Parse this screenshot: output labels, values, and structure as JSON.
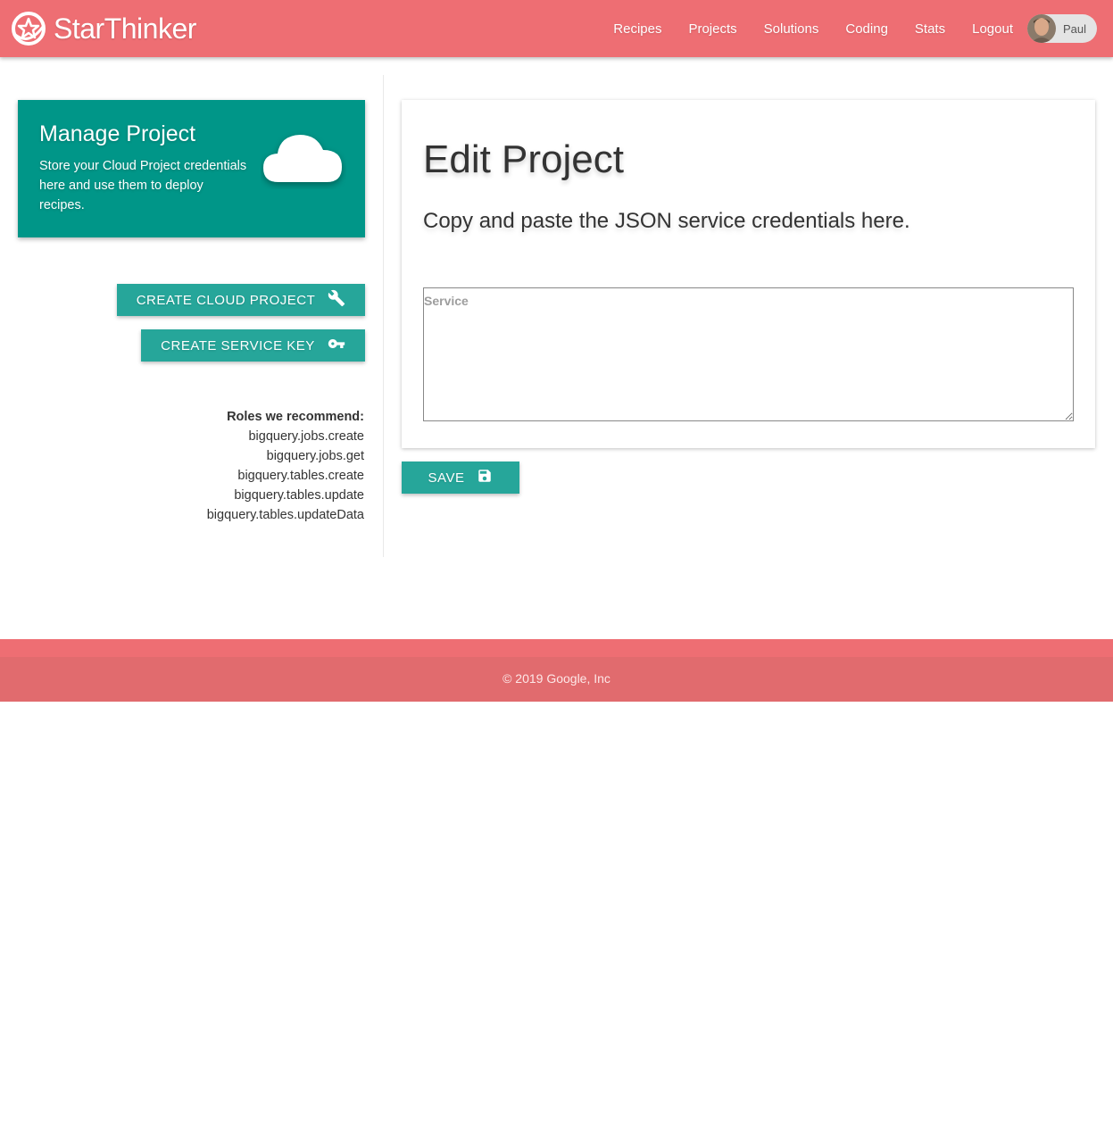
{
  "app": {
    "brand": "StarThinker"
  },
  "nav": {
    "items": [
      {
        "label": "Recipes"
      },
      {
        "label": "Projects"
      },
      {
        "label": "Solutions"
      },
      {
        "label": "Coding"
      },
      {
        "label": "Stats"
      },
      {
        "label": "Logout"
      }
    ],
    "user": {
      "name": "Paul",
      "avatar_icon": "user-avatar"
    }
  },
  "manage_card": {
    "title": "Manage Project",
    "description": "Store your Cloud Project credentials here and use them to deploy recipes.",
    "icon": "cloud-icon"
  },
  "actions": {
    "create_cloud_project": {
      "label": "CREATE CLOUD PROJECT",
      "icon": "wrench-icon"
    },
    "create_service_key": {
      "label": "CREATE SERVICE KEY",
      "icon": "key-icon"
    }
  },
  "roles": {
    "heading": "Roles we recommend:",
    "items": [
      "bigquery.jobs.create",
      "bigquery.jobs.get",
      "bigquery.tables.create",
      "bigquery.tables.update",
      "bigquery.tables.updateData"
    ]
  },
  "edit": {
    "title": "Edit Project",
    "subtitle": "Copy and paste the JSON service credentials here.",
    "service_placeholder": "Service",
    "service_value": ""
  },
  "save": {
    "label": "SAVE",
    "icon": "save-icon"
  },
  "footer": {
    "copyright": "© 2019 Google, Inc"
  },
  "colors": {
    "header": "#ee6e73",
    "footer": "#e16b6e",
    "card_teal": "#009688",
    "button_teal": "#26a69a"
  }
}
